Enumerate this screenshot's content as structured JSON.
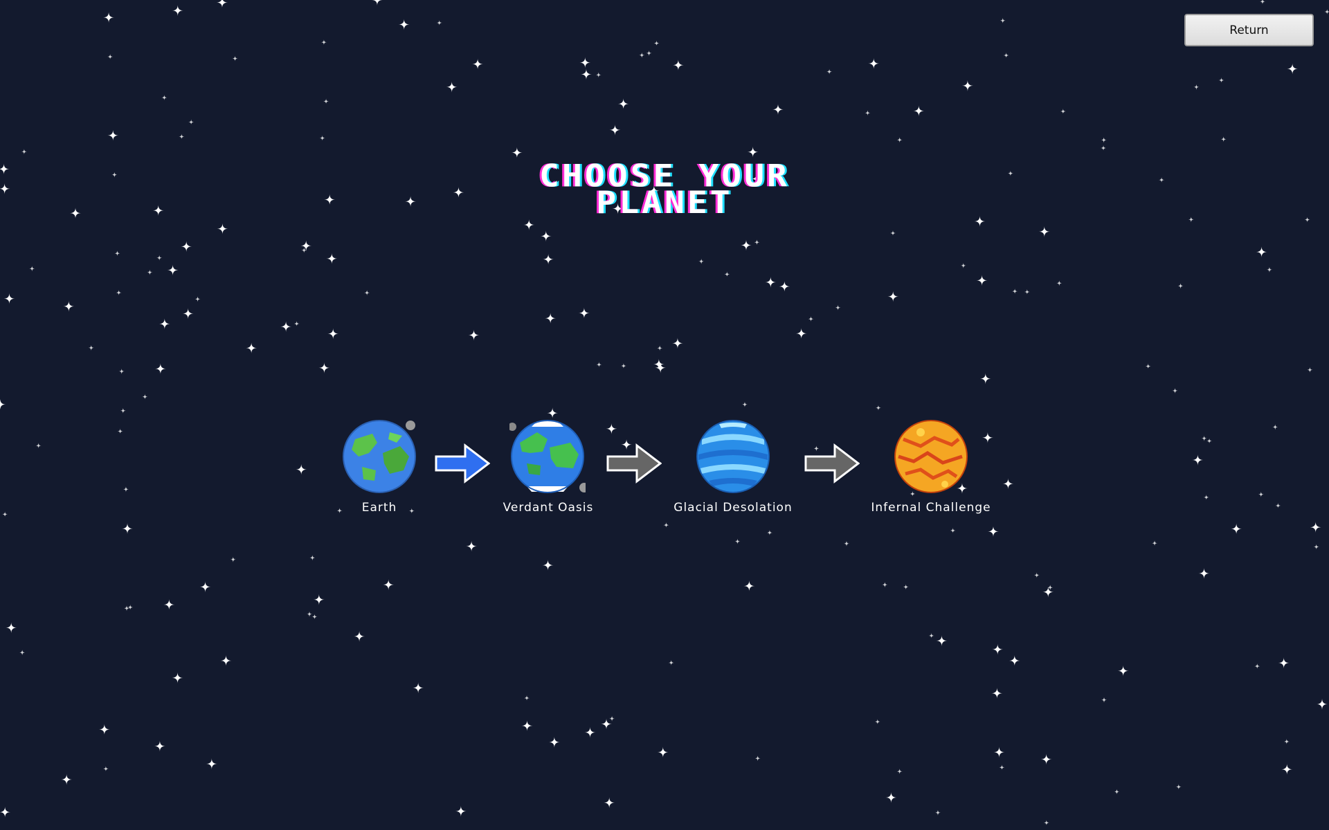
{
  "window": {
    "background_color": "#131a2e"
  },
  "return_button": {
    "label": "Return"
  },
  "title": {
    "line1": "CHOOSE YOUR",
    "line2": "PLANET"
  },
  "planets": [
    {
      "label": "Earth",
      "icon": "earth-planet-icon",
      "colors": [
        "#3c82e6",
        "#5cc24a"
      ]
    },
    {
      "label": "Verdant Oasis",
      "icon": "verdant-oasis-planet-icon",
      "colors": [
        "#2f7ee6",
        "#46c04e"
      ]
    },
    {
      "label": "Glacial Desolation",
      "icon": "glacial-planet-icon",
      "colors": [
        "#2a8ee8",
        "#8ad8ff"
      ]
    },
    {
      "label": "Infernal Challenge",
      "icon": "infernal-planet-icon",
      "colors": [
        "#f5a623",
        "#e0501a"
      ]
    }
  ],
  "arrows": [
    {
      "icon": "arrow-right-icon",
      "color": "#2f6ff0",
      "state": "active"
    },
    {
      "icon": "arrow-right-icon",
      "color": "#666666",
      "state": "locked"
    },
    {
      "icon": "arrow-right-icon",
      "color": "#666666",
      "state": "locked"
    }
  ]
}
